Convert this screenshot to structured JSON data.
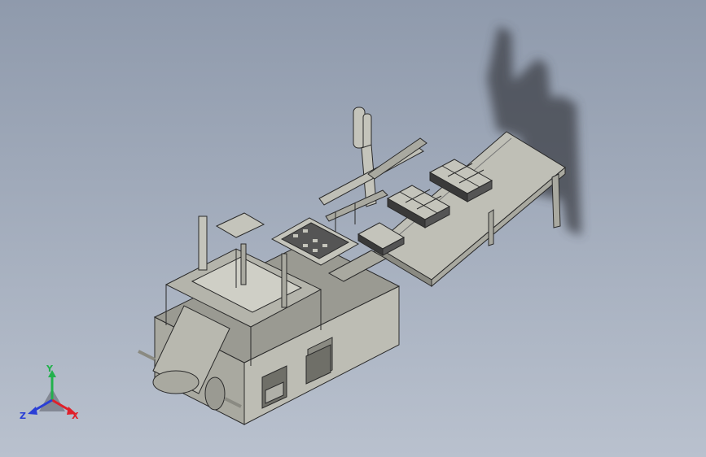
{
  "viewport": {
    "background_top": "#8f9aac",
    "background_bottom": "#b9c1ce"
  },
  "model": {
    "face_light": "#c4c4bb",
    "face_mid": "#a9a9a0",
    "face_dark": "#8a8a82",
    "edge": "#2a2a2a",
    "shadow": "#3c3f46"
  },
  "triad": {
    "x_label": "X",
    "y_label": "Y",
    "z_label": "Z",
    "x_color": "#e0202a",
    "y_color": "#22b14c",
    "z_color": "#2a3fd6"
  }
}
